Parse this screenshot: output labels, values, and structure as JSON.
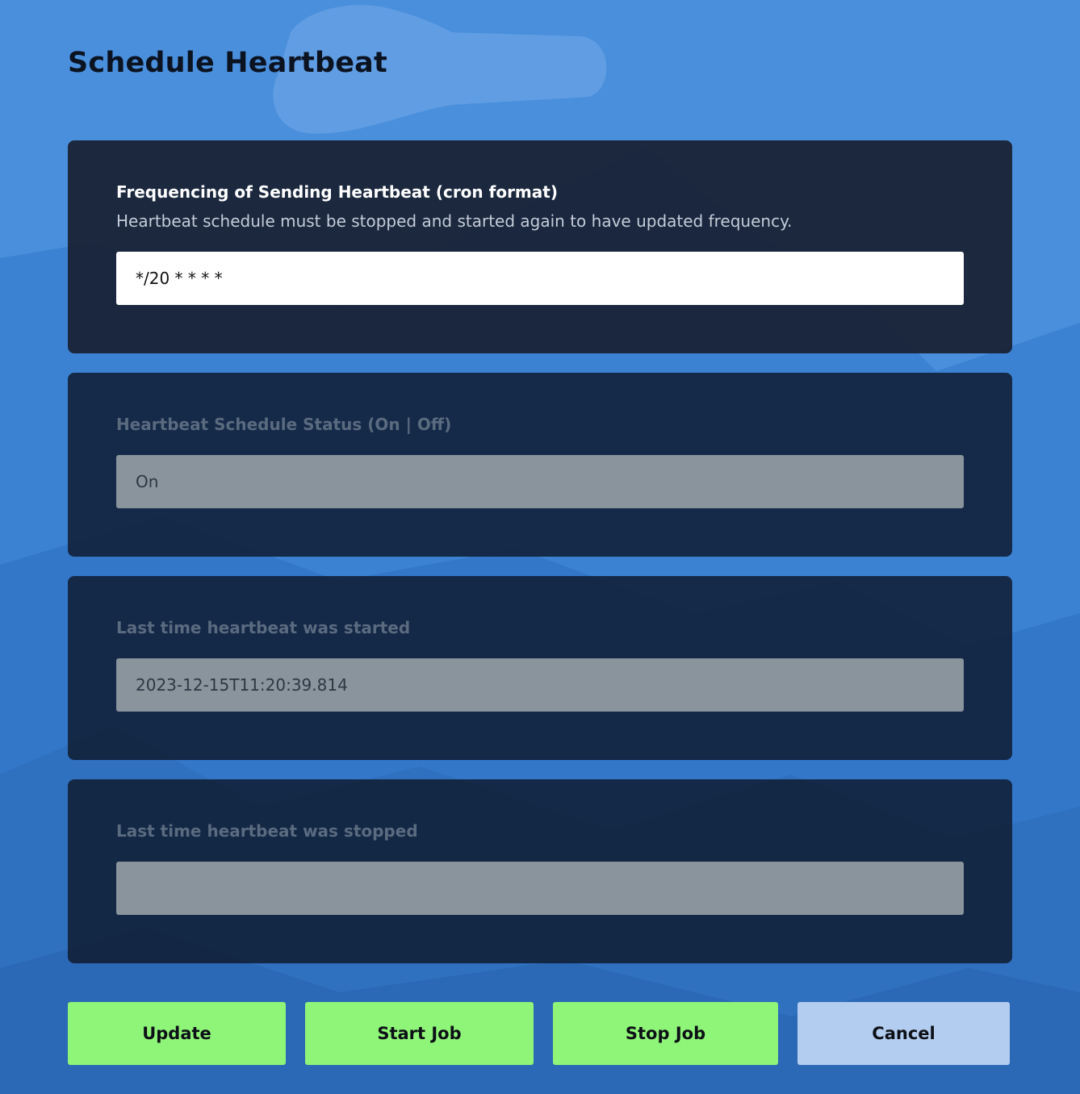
{
  "page": {
    "title": "Schedule Heartbeat"
  },
  "frequency": {
    "label": "Frequencing of Sending Heartbeat (cron format)",
    "help": "Heartbeat schedule must be stopped and started again to have updated frequency.",
    "value": "*/20 * * * *"
  },
  "status": {
    "label": "Heartbeat Schedule Status (On | Off)",
    "value": "On"
  },
  "last_started": {
    "label": "Last time heartbeat was started",
    "value": "2023-12-15T11:20:39.814"
  },
  "last_stopped": {
    "label": "Last time heartbeat was stopped",
    "value": ""
  },
  "actions": {
    "update": "Update",
    "start": "Start Job",
    "stop": "Stop Job",
    "cancel": "Cancel"
  },
  "colors": {
    "background": "#4a8fdc",
    "action_green": "#8ff578",
    "cancel": "#b3cdf0"
  }
}
